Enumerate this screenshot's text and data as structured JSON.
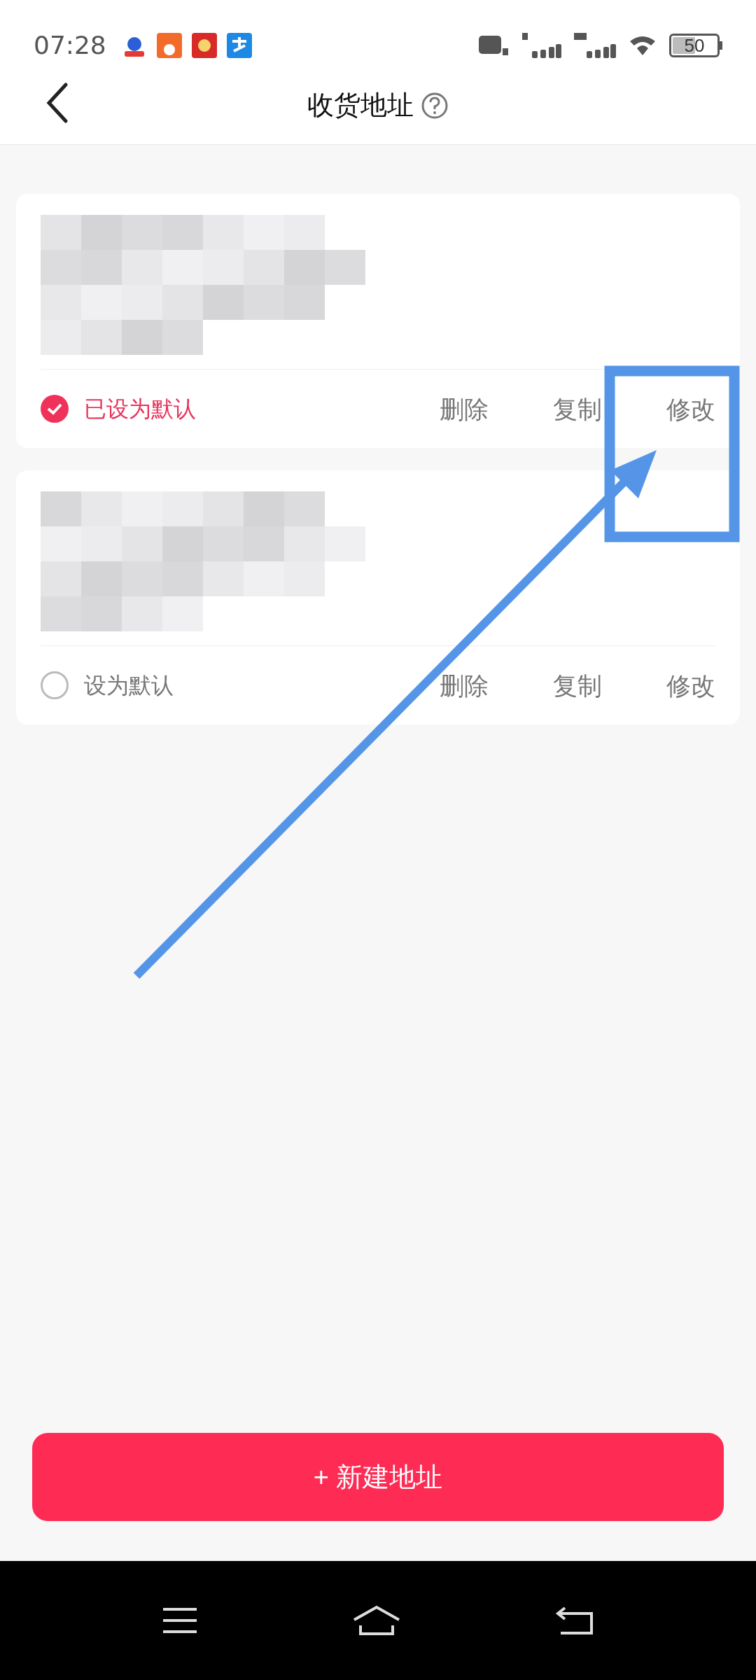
{
  "status_bar": {
    "time": "07:28",
    "battery": "50"
  },
  "header": {
    "title": "收货地址"
  },
  "addresses": [
    {
      "default_label": "已设为默认",
      "selected": true,
      "actions": [
        "删除",
        "复制",
        "修改"
      ]
    },
    {
      "default_label": "设为默认",
      "selected": false,
      "actions": [
        "删除",
        "复制",
        "修改"
      ]
    }
  ],
  "new_button": {
    "label": "+ 新建地址"
  }
}
